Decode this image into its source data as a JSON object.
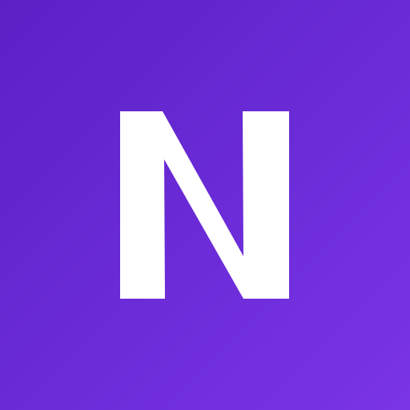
{
  "app_icon": {
    "letter": "N",
    "icon_name": "letter-n-logo-icon",
    "colors": {
      "background_start": "#5b21c5",
      "background_end": "#7a34e6",
      "glyph": "#ffffff"
    }
  }
}
